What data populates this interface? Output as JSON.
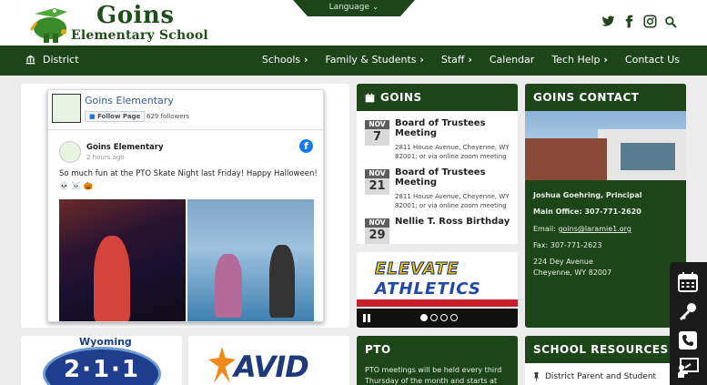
{
  "header": {
    "school_name_line1": "Goins",
    "school_name_line2": "Elementary School",
    "language_label": "Language",
    "social_icons": [
      "twitter-icon",
      "facebook-icon",
      "instagram-icon",
      "search-icon"
    ]
  },
  "nav": {
    "district_label": "District",
    "items": [
      {
        "label": "Schools",
        "dropdown": true
      },
      {
        "label": "Family & Students",
        "dropdown": true
      },
      {
        "label": "Staff",
        "dropdown": true
      },
      {
        "label": "Calendar",
        "dropdown": false
      },
      {
        "label": "Tech Help",
        "dropdown": true
      },
      {
        "label": "Contact Us",
        "dropdown": false
      }
    ]
  },
  "facebook": {
    "page_name": "Goins Elementary",
    "follow_label": "Follow Page",
    "followers": "629 followers",
    "post_author": "Goins Elementary",
    "post_time": "2 hours ago",
    "post_text": "So much fun at the PTO Skate Night last Friday! Happy Halloween! 💀 ☠️ 🎃"
  },
  "calendar": {
    "title": "GOINS",
    "events": [
      {
        "month": "NOV",
        "day": "7",
        "title": "Board of Trustees Meeting",
        "location": "2811 House Avenue, Cheyenne, WY 82001; or via online zoom meeting"
      },
      {
        "month": "NOV",
        "day": "21",
        "title": "Board of Trustees Meeting",
        "location": "2811 House Avenue, Cheyenne, WY 82001; or via online zoom meeting"
      },
      {
        "month": "NOV",
        "day": "29",
        "title": "Nellie T. Ross Birthday",
        "location": ""
      }
    ]
  },
  "slider": {
    "line1": "ELEVATE",
    "line2": "ATHLETICS",
    "dots": 4,
    "active_dot": 0
  },
  "contact": {
    "title": "GOINS CONTACT",
    "principal": "Joshua Goehring, Principal",
    "main_office": "Main Office: 307-771-2620",
    "email_label": "Email: ",
    "email": "goins@laramie1.org",
    "fax": "Fax: 307-771-2623",
    "address1": "224 Dey Avenue",
    "address2": "Cheyenne, WY 82007"
  },
  "bottom": {
    "wyoming_text": "Wyoming",
    "wyoming_num": "2·1·1",
    "avid_text": "AVID",
    "pto_title": "PTO",
    "pto_text": "PTO meetings will be held every third Thursday of the month and starts at",
    "resources_title": "SCHOOL RESOURCES",
    "resources_item": "District Parent and Student"
  },
  "quick_links": [
    "calendar-icon",
    "key-icon",
    "phone-icon",
    "presentation-icon"
  ],
  "colors": {
    "brand_green": "#1d4519",
    "accent_gold": "#f2c500"
  }
}
